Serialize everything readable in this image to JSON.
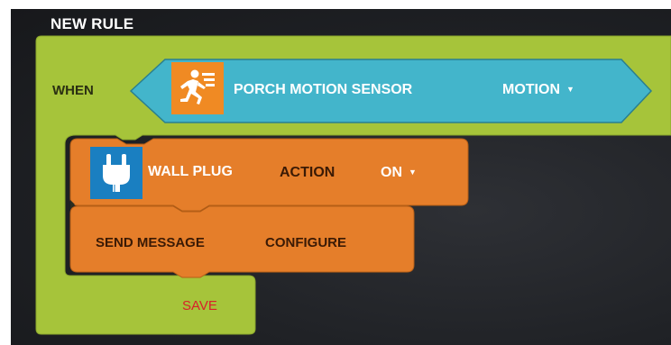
{
  "rule": {
    "title": "NEW RULE",
    "when_label": "WHEN"
  },
  "trigger": {
    "device": "PORCH MOTION SENSOR",
    "device_icon": "running-person-icon",
    "value": "MOTION",
    "value_caret": "▼"
  },
  "actions": [
    {
      "device": "WALL PLUG",
      "device_icon": "plug-icon",
      "label": "ACTION",
      "value": "ON",
      "value_caret": "▼"
    },
    {
      "device": "SEND MESSAGE",
      "label": "CONFIGURE"
    }
  ],
  "footer": {
    "save_label": "SAVE"
  },
  "colors": {
    "rule_block": "#a6c43a",
    "trigger_block": "#43b5cb",
    "action_block": "#e57e2a",
    "sensor_icon_bg": "#f08a23",
    "plug_icon_bg": "#1a7fc1",
    "save_text": "#d9202a"
  }
}
